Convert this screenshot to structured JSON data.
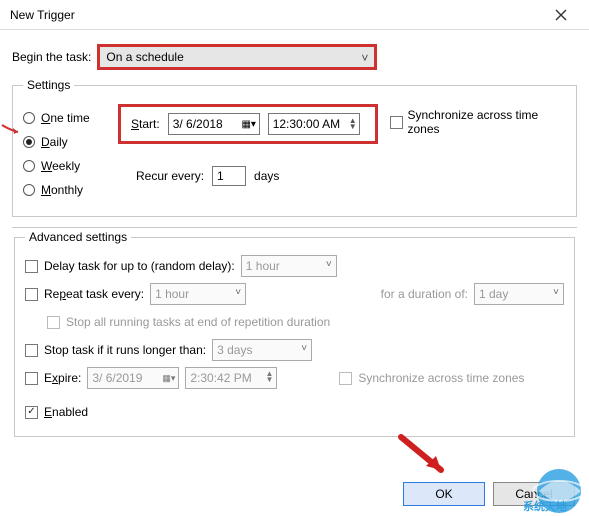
{
  "title": "New Trigger",
  "begin_label": "Begin the task:",
  "begin_value": "On a schedule",
  "settings": {
    "legend": "Settings",
    "freq": {
      "one_time": "One time",
      "daily": "Daily",
      "weekly": "Weekly",
      "monthly": "Monthly"
    },
    "start_label": "Start:",
    "start_date": "3/ 6/2018",
    "start_time": "12:30:00 AM",
    "sync_label": "Synchronize across time zones",
    "recur_label": "Recur every:",
    "recur_value": "1",
    "recur_unit": "days"
  },
  "adv": {
    "legend": "Advanced settings",
    "delay_label": "Delay task for up to (random delay):",
    "delay_value": "1 hour",
    "repeat_label": "Repeat task every:",
    "repeat_value": "1 hour",
    "duration_label": "for a duration of:",
    "duration_value": "1 day",
    "stop_all_label": "Stop all running tasks at end of repetition duration",
    "stop_if_label": "Stop task if it runs longer than:",
    "stop_if_value": "3 days",
    "expire_label": "Expire:",
    "expire_date": "3/ 6/2019",
    "expire_time": "2:30:42 PM",
    "expire_sync_label": "Synchronize across time zones",
    "enabled_label": "Enabled"
  },
  "buttons": {
    "ok": "OK",
    "cancel": "Cancel"
  },
  "watermark": "系统天地"
}
